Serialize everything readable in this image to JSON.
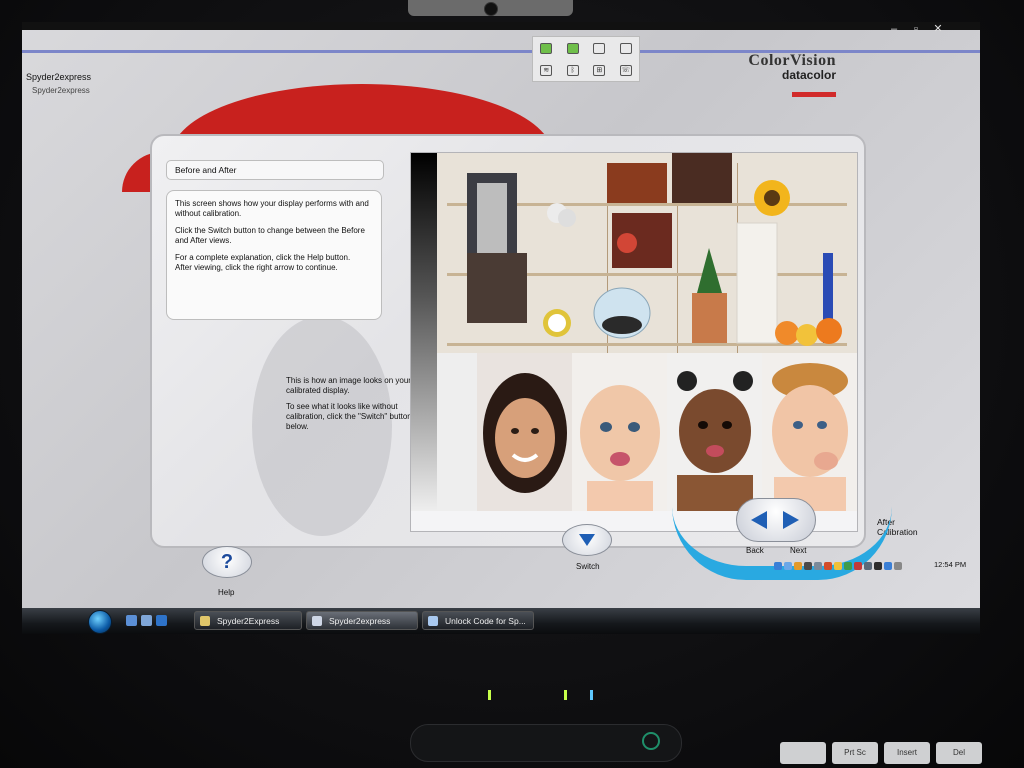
{
  "window": {
    "title_outer": "Spyder2express",
    "title_inner": "Spyder2express",
    "controls": [
      "–",
      "▫",
      "✕"
    ]
  },
  "brand": {
    "top": "ColorVision",
    "bottom": "datacolor",
    "accent_color": "#d12a2a"
  },
  "instructions": {
    "heading": "Before and After",
    "paragraphs": [
      "This screen shows how your display performs with and without calibration.",
      "Click the Switch button to change between the Before and After views.",
      "For a complete explanation, click the Help button.",
      "After viewing, click the right arrow to continue."
    ]
  },
  "calibration_note": {
    "paragraphs": [
      "This is how an image looks on your calibrated display.",
      "To see what it looks like without calibration, click the \"Switch\" button below."
    ]
  },
  "image": {
    "caption": "After Calibration"
  },
  "controls": {
    "help_label": "Help",
    "help_glyph": "?",
    "switch_label": "Switch",
    "back_label": "Back",
    "next_label": "Next"
  },
  "taskbar": {
    "buttons": [
      {
        "label": "Spyder2Express",
        "active": false
      },
      {
        "label": "Spyder2express",
        "active": true
      },
      {
        "label": "Unlock Code for Sp...",
        "active": false
      }
    ],
    "clock": "12:54 PM"
  },
  "keyboard": {
    "keys": [
      "",
      "Prt Sc",
      "Insert",
      "Del"
    ]
  },
  "colors": {
    "red_accent": "#c8211e",
    "blue_accent": "#29a9e1",
    "nav_arrow": "#1f5fb5"
  }
}
